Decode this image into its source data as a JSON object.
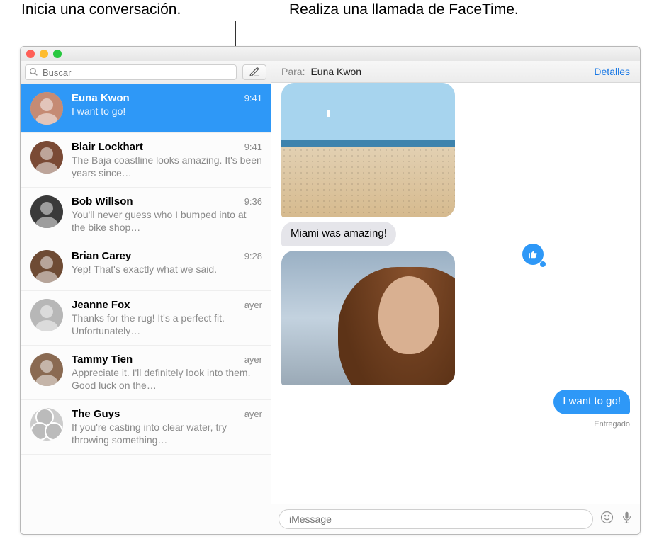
{
  "callouts": {
    "left": "Inicia una conversación.",
    "right": "Realiza una llamada de FaceTime."
  },
  "search": {
    "placeholder": "Buscar"
  },
  "conversations": [
    {
      "name": "Euna Kwon",
      "time": "9:41",
      "preview": "I want to go!",
      "selected": true,
      "avatar_color": "#c58b74"
    },
    {
      "name": "Blair Lockhart",
      "time": "9:41",
      "preview": "The Baja coastline looks amazing. It's been years since…",
      "avatar_color": "#7a4a35"
    },
    {
      "name": "Bob Willson",
      "time": "9:36",
      "preview": "You'll never guess who I bumped into at the bike shop…",
      "avatar_color": "#3a3a3a"
    },
    {
      "name": "Brian Carey",
      "time": "9:28",
      "preview": "Yep! That's exactly what we said.",
      "avatar_color": "#6e4b34"
    },
    {
      "name": "Jeanne Fox",
      "time": "ayer",
      "preview": "Thanks for the rug! It's a perfect fit. Unfortunately…",
      "avatar_color": "#b7b7b7"
    },
    {
      "name": "Tammy Tien",
      "time": "ayer",
      "preview": "Appreciate it. I'll definitely look into them. Good luck on the…",
      "avatar_color": "#8a6a52"
    },
    {
      "name": "The Guys",
      "time": "ayer",
      "preview": "If you're casting into clear water, try throwing something…",
      "group": true
    }
  ],
  "chat": {
    "to_label": "Para:",
    "to_name": "Euna Kwon",
    "details": "Detalles",
    "messages": [
      {
        "type": "image",
        "dir": "in",
        "kind": "beach"
      },
      {
        "type": "text",
        "dir": "in",
        "text": "Miami was amazing!"
      },
      {
        "type": "image",
        "dir": "in",
        "kind": "portrait",
        "reaction": "thumbs-up"
      },
      {
        "type": "text",
        "dir": "out",
        "text": "I want to go!",
        "status": "Entregado"
      }
    ],
    "input_placeholder": "iMessage"
  }
}
